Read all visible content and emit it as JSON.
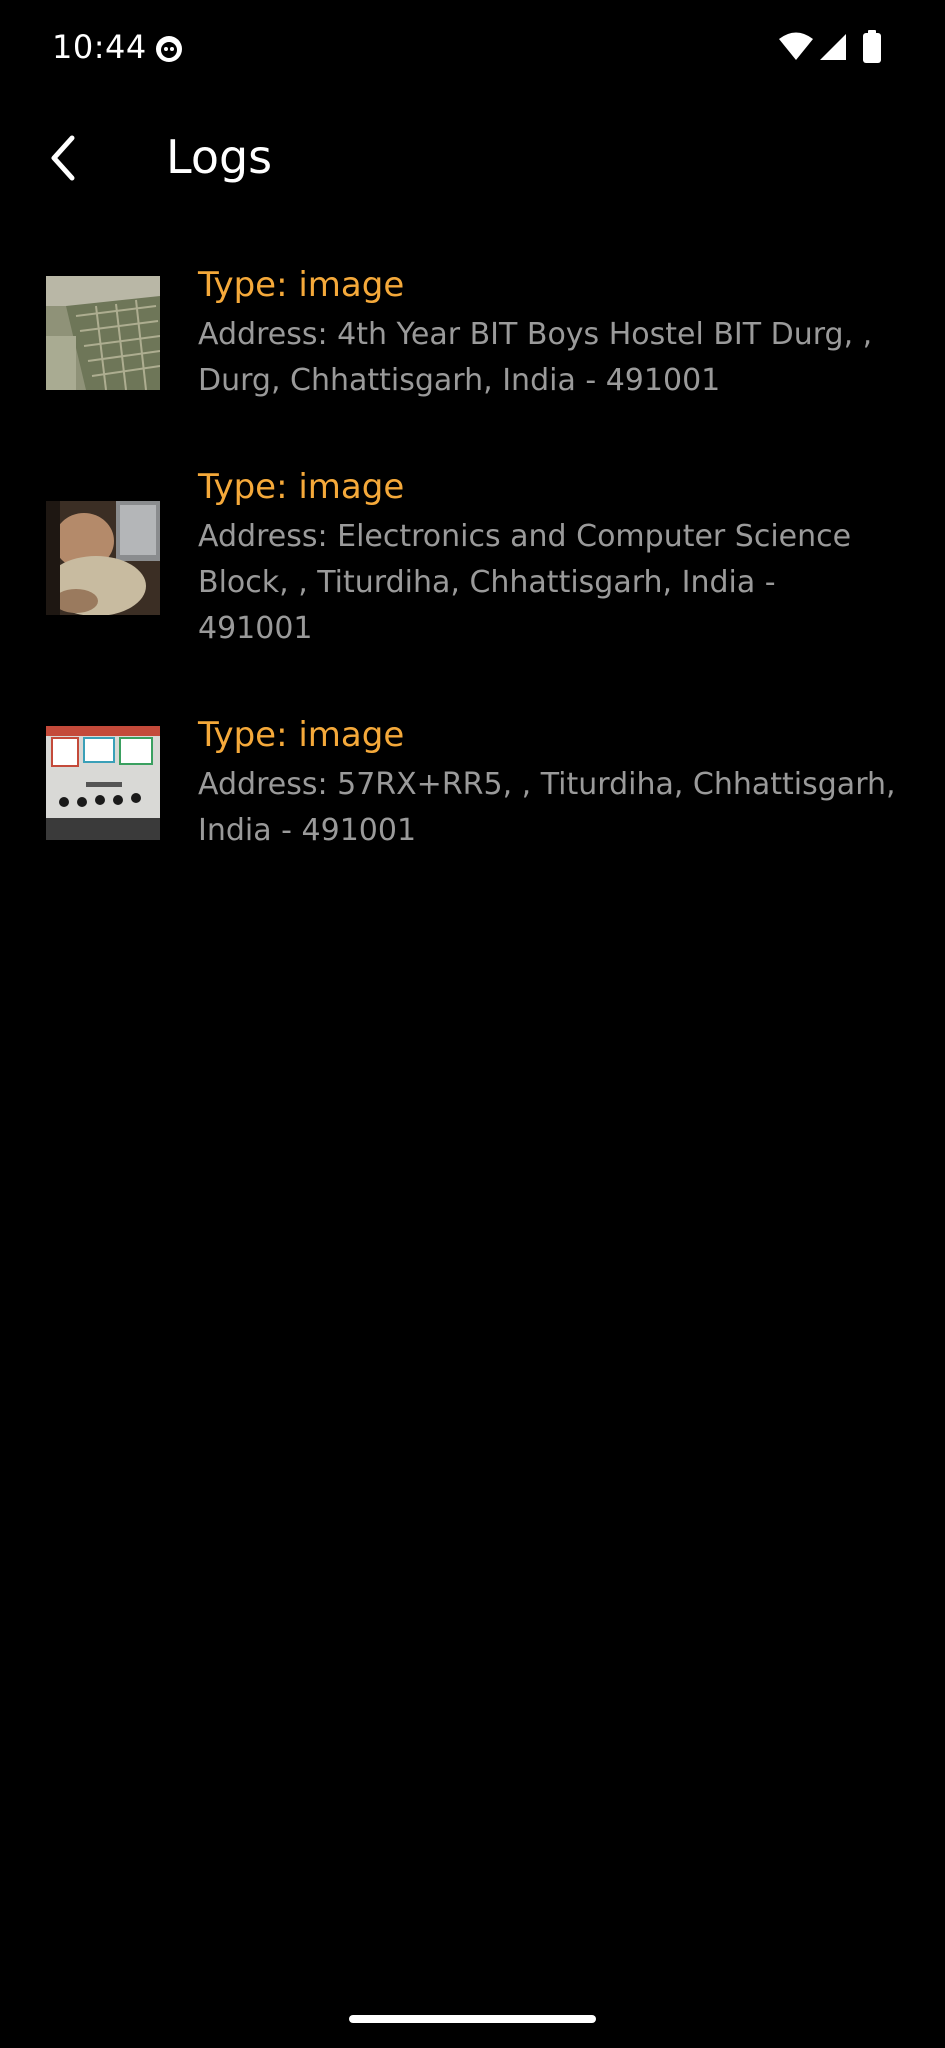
{
  "status_bar": {
    "time": "10:44",
    "icons": [
      "app-notification-icon",
      "wifi-icon",
      "signal-icon",
      "battery-icon"
    ]
  },
  "header": {
    "back_icon": "back-arrow-icon",
    "title": "Logs"
  },
  "logs": [
    {
      "type": "Type: image",
      "address": "Address: 4th Year BIT Boys Hostel BIT Durg, , Durg, Chhattisgarh, India - 491001",
      "thumbnail": "thumbnail-floor-icon"
    },
    {
      "type": "Type: image",
      "address": "Address: Electronics and Computer Science Block, , Titurdiha, Chhattisgarh, India - 491001",
      "thumbnail": "thumbnail-person-laptop-icon"
    },
    {
      "type": "Type: image",
      "address": "Address: 57RX+RR5, , Titurdiha, Chhattisgarh, India - 491001",
      "thumbnail": "thumbnail-poster-icon"
    }
  ],
  "colors": {
    "background": "#000000",
    "accent": "#F5A93A",
    "secondary_text": "#9a9a9a",
    "primary_text": "#ffffff"
  }
}
